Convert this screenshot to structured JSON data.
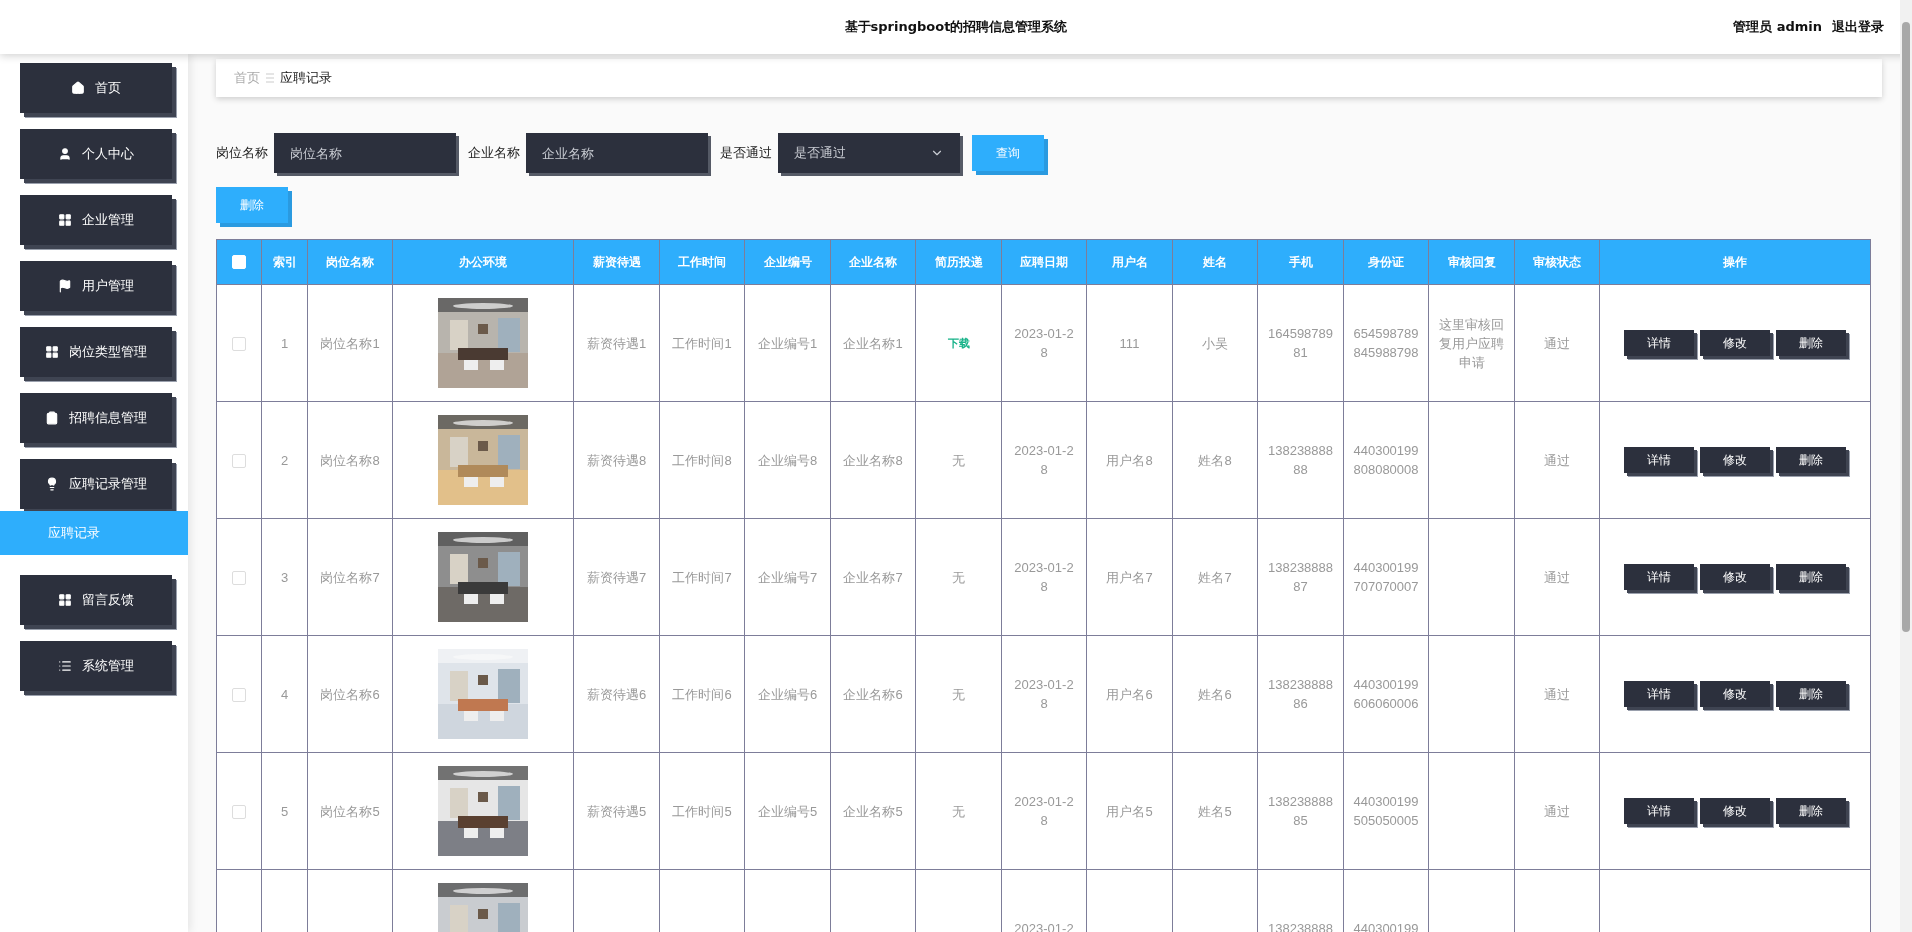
{
  "header": {
    "title": "基于springboot的招聘信息管理系统",
    "user": "管理员 admin",
    "logout": "退出登录"
  },
  "sidebar": {
    "items": [
      {
        "label": "首页"
      },
      {
        "label": "个人中心"
      },
      {
        "label": "企业管理"
      },
      {
        "label": "用户管理"
      },
      {
        "label": "岗位类型管理"
      },
      {
        "label": "招聘信息管理"
      },
      {
        "label": "应聘记录管理",
        "children": [
          {
            "label": "应聘记录",
            "selected": true
          }
        ]
      },
      {
        "label": "留言反馈"
      },
      {
        "label": "系统管理"
      }
    ]
  },
  "breadcrumb": [
    "首页",
    "应聘记录"
  ],
  "search": {
    "fields": [
      {
        "kind": "input",
        "label": "岗位名称",
        "placeholder": "岗位名称"
      },
      {
        "kind": "input",
        "label": "企业名称",
        "placeholder": "企业名称"
      },
      {
        "kind": "select",
        "label": "是否通过",
        "placeholder": "是否通过"
      }
    ],
    "button": "查询"
  },
  "delete_button": "删除",
  "table": {
    "all_checked": false,
    "columns": [
      "索引",
      "岗位名称",
      "办公环境",
      "薪资待遇",
      "工作时间",
      "企业编号",
      "企业名称",
      "简历投递",
      "应聘日期",
      "用户名",
      "姓名",
      "手机",
      "身份证",
      "审核回复",
      "审核状态",
      "操作"
    ],
    "rows": [
      {
        "checked": false,
        "index": "1",
        "job": "岗位名称1",
        "salary": "薪资待遇1",
        "work_time": "工作时间1",
        "company_no": "企业编号1",
        "company_name": "企业名称1",
        "resume": {
          "kind": "link",
          "text": "下载"
        },
        "date": "2023-01-28",
        "username": "111",
        "name": "小吴",
        "phone": "16459878981",
        "id_card": "654598789845988798",
        "reply": "这里审核回复用户应聘申请",
        "status": "通过",
        "actions": [
          "详情",
          "修改",
          "删除"
        ]
      },
      {
        "checked": false,
        "index": "2",
        "job": "岗位名称8",
        "salary": "薪资待遇8",
        "work_time": "工作时间8",
        "company_no": "企业编号8",
        "company_name": "企业名称8",
        "resume": {
          "kind": "text",
          "text": "无"
        },
        "date": "2023-01-28",
        "username": "用户名8",
        "name": "姓名8",
        "phone": "13823888888",
        "id_card": "440300199808080008",
        "status": "通过",
        "actions": [
          "详情",
          "修改",
          "删除"
        ]
      },
      {
        "checked": false,
        "index": "3",
        "job": "岗位名称7",
        "salary": "薪资待遇7",
        "work_time": "工作时间7",
        "company_no": "企业编号7",
        "company_name": "企业名称7",
        "resume": {
          "kind": "text",
          "text": "无"
        },
        "date": "2023-01-28",
        "username": "用户名7",
        "name": "姓名7",
        "phone": "13823888887",
        "id_card": "440300199707070007",
        "status": "通过",
        "actions": [
          "详情",
          "修改",
          "删除"
        ]
      },
      {
        "checked": false,
        "index": "4",
        "job": "岗位名称6",
        "salary": "薪资待遇6",
        "work_time": "工作时间6",
        "company_no": "企业编号6",
        "company_name": "企业名称6",
        "resume": {
          "kind": "text",
          "text": "无"
        },
        "date": "2023-01-28",
        "username": "用户名6",
        "name": "姓名6",
        "phone": "13823888886",
        "id_card": "440300199606060006",
        "status": "通过",
        "actions": [
          "详情",
          "修改",
          "删除"
        ]
      },
      {
        "checked": false,
        "index": "5",
        "job": "岗位名称5",
        "salary": "薪资待遇5",
        "work_time": "工作时间5",
        "company_no": "企业编号5",
        "company_name": "企业名称5",
        "resume": {
          "kind": "text",
          "text": "无"
        },
        "date": "2023-01-28",
        "username": "用户名5",
        "name": "姓名5",
        "phone": "13823888885",
        "id_card": "440300199505050005",
        "status": "通过",
        "actions": [
          "详情",
          "修改",
          "删除"
        ]
      },
      {
        "date": "2023-01-2",
        "phone": "138238888",
        "id_card": "440300199"
      }
    ]
  }
}
